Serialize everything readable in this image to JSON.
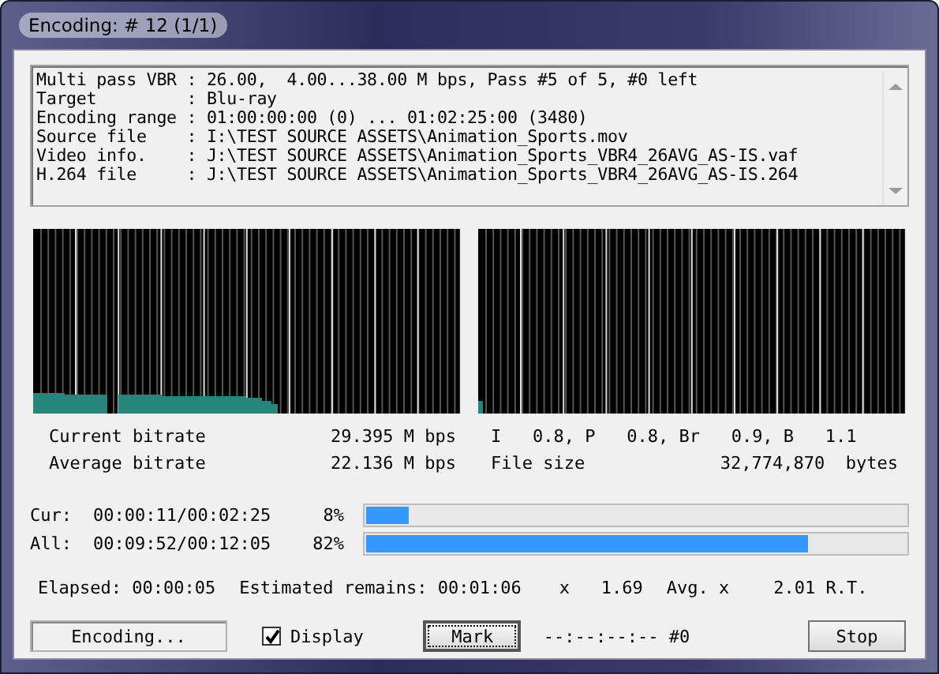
{
  "window": {
    "title": "Encoding: # 12 (1/1)"
  },
  "log": {
    "lines": [
      "Multi pass VBR : 26.00,  4.00...38.00 M bps, Pass #5 of 5, #0 left",
      "Target         : Blu-ray",
      "Encoding range : 01:00:00:00 (0) ... 01:02:25:00 (3480)",
      "Source file    : I:\\TEST SOURCE ASSETS\\Animation_Sports.mov",
      "Video info.    : J:\\TEST SOURCE ASSETS\\Animation_Sports_VBR4_26AVG_AS-IS.vaf",
      "H.264 file     : J:\\TEST SOURCE ASSETS\\Animation_Sports_VBR4_26AVG_AS-IS.264"
    ]
  },
  "stats": [
    {
      "label": "Current bitrate",
      "value": "29.395 M bps",
      "right_label": "I   0.8, P   0.8, Br   0.9, B   1.1"
    },
    {
      "label": "Average bitrate",
      "value": "22.136 M bps",
      "right_label": "File size",
      "right_value": "32,774,870  bytes"
    }
  ],
  "progress": [
    {
      "label": "Cur:",
      "time": "00:00:11/00:02:25",
      "percent": "8%",
      "level": 0.08
    },
    {
      "label": "All:",
      "time": "00:09:52/00:12:05",
      "percent": "82%",
      "level": 0.82
    }
  ],
  "timing": {
    "elapsed": "Elapsed: 00:00:05",
    "remains": "Estimated remains: 00:01:06",
    "speed": "x   1.69",
    "avg_label": "Avg. x",
    "avg_value": "2.01 R.T."
  },
  "footer": {
    "status": "Encoding...",
    "display": {
      "label": "Display",
      "checked": true
    },
    "mark": "Mark",
    "timecode": "--:--:--:-- #0",
    "stop": "Stop"
  }
}
